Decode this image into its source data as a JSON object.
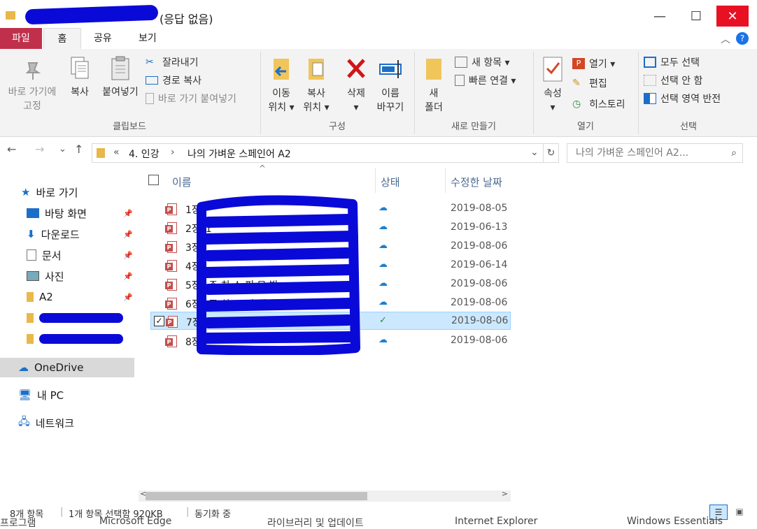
{
  "window": {
    "title_suffix": "(응답 없음)",
    "minimize": "—",
    "maximize": "☐",
    "close": "✕"
  },
  "ribbon": {
    "tabs": [
      {
        "label": "파일"
      },
      {
        "label": "홈"
      },
      {
        "label": "공유"
      },
      {
        "label": "보기"
      }
    ],
    "clipboard": {
      "pin_line1": "바로 가기에",
      "pin_line2": "고정",
      "copy": "복사",
      "paste": "붙여넣기",
      "cut": "잘라내기",
      "copy_path": "경로 복사",
      "paste_shortcut": "바로 가기 붙여넣기",
      "group": "클립보드"
    },
    "organize": {
      "move_l1": "이동",
      "move_l2": "위치 ▾",
      "copyto_l1": "복사",
      "copyto_l2": "위치 ▾",
      "delete_l1": "삭제",
      "delete_l2": "▾",
      "rename_l1": "이름",
      "rename_l2": "바꾸기",
      "group": "구성"
    },
    "new": {
      "folder_l1": "새",
      "folder_l2": "폴더",
      "new_item": "새 항목 ▾",
      "easy_access": "빠른 연결 ▾",
      "group": "새로 만들기"
    },
    "open": {
      "properties_l1": "속성",
      "properties_l2": "▾",
      "open": "열기 ▾",
      "edit": "편집",
      "history": "히스토리",
      "group": "열기"
    },
    "select": {
      "select_all": "모두 선택",
      "select_none": "선택 안 함",
      "invert": "선택 영역 반전",
      "group": "선택"
    }
  },
  "address": {
    "back": "←",
    "forward": "→",
    "recent": "⌄",
    "up": "↑",
    "crumb_overflow": "«",
    "crumb1": "4. 인강",
    "crumb_sep": "›",
    "crumb2": "나의 가벼운 스페인어 A2",
    "dropdown": "⌄",
    "refresh": "↻",
    "search_placeholder": "나의 가벼운 스페인어 A2...",
    "search_icon": "⌕"
  },
  "nav": {
    "quick_access": "바로 가기",
    "items": [
      {
        "label": "바탕 화면"
      },
      {
        "label": "다운로드"
      },
      {
        "label": "문서"
      },
      {
        "label": "사진"
      },
      {
        "label": "A2"
      }
    ],
    "onedrive": "OneDrive",
    "pc": "내 PC",
    "network": "네트워크"
  },
  "columns": {
    "name": "이름",
    "status": "상태",
    "modified": "수정한 날짜"
  },
  "files": [
    {
      "name": "1장_",
      "date": "2019-08-05",
      "status": "cloud"
    },
    {
      "name": "2장_1",
      "date": "2019-06-13",
      "status": "cloud"
    },
    {
      "name": "3장_",
      "date": "2019-08-06",
      "status": "cloud"
    },
    {
      "name": "4장_",
      "date": "2019-06-14",
      "status": "cloud"
    },
    {
      "name": "5장_ 주 치 스 피 모 발",
      "date": "2019-08-06",
      "status": "cloud"
    },
    {
      "name": "6장_ 조 치 스 피 치 하 구 하",
      "date": "2019-08-06",
      "status": "cloud"
    },
    {
      "name": "7장_2",
      "date": "2019-08-06",
      "status": "synced"
    },
    {
      "name": "8장_",
      "date": "2019-08-06",
      "status": "cloud"
    }
  ],
  "statusbar": {
    "count": "8개 항목",
    "selected": "1개 항목 선택함 920KB",
    "sync": "동기화 중"
  },
  "taskbar": {
    "t1": "프로그램",
    "t2": "Microsoft Edge",
    "t3": "라이브러리 및 업데이트",
    "t4": "Internet Explorer",
    "t5": "Windows Essentials"
  }
}
